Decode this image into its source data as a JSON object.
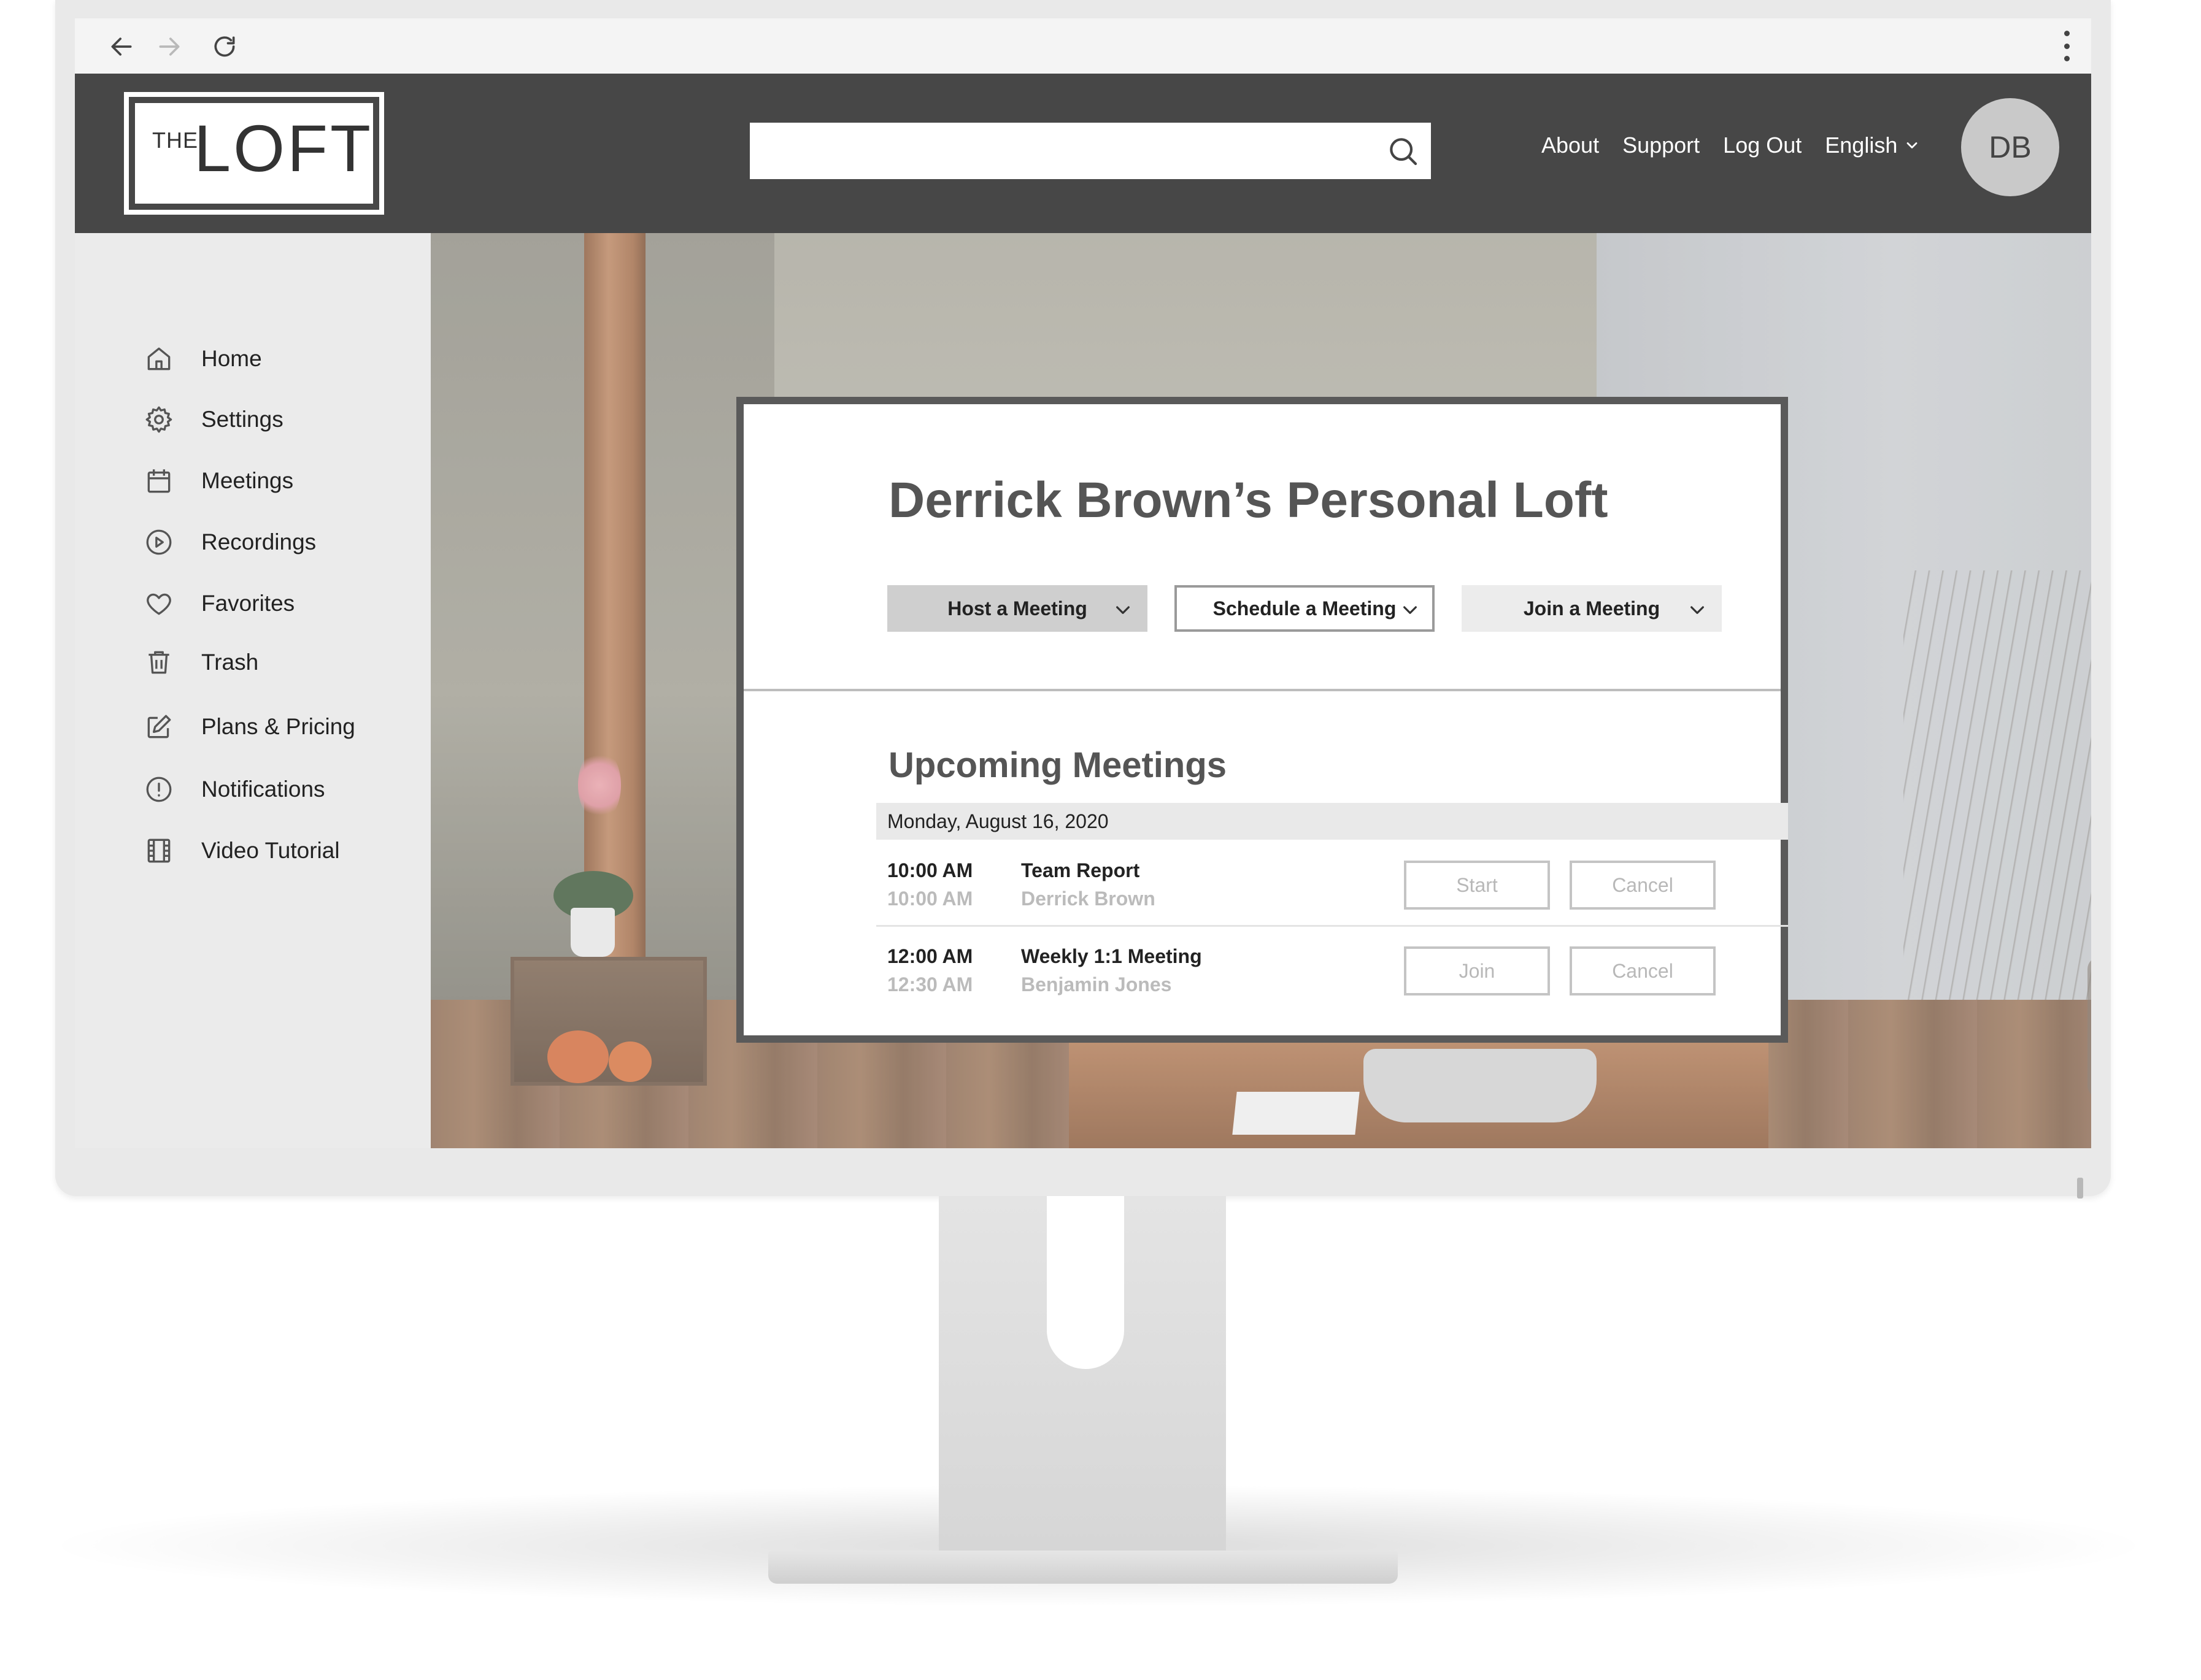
{
  "browser": {
    "icons": [
      "back-arrow-icon",
      "forward-arrow-icon",
      "reload-icon",
      "more-vert-icon"
    ]
  },
  "header": {
    "logo_small": "THE",
    "logo_big": "LOFT",
    "search_placeholder": "",
    "links": [
      "About",
      "Support",
      "Log Out"
    ],
    "language": "English",
    "avatar_initials": "DB"
  },
  "sidebar": {
    "items": [
      {
        "label": "Home",
        "icon": "home-icon"
      },
      {
        "label": "Settings",
        "icon": "gear-icon"
      },
      {
        "label": "Meetings",
        "icon": "calendar-icon"
      },
      {
        "label": "Recordings",
        "icon": "play-circle-icon"
      },
      {
        "label": "Favorites",
        "icon": "heart-icon"
      },
      {
        "label": "Trash",
        "icon": "trash-icon"
      },
      {
        "label": "Plans & Pricing",
        "icon": "edit-icon"
      },
      {
        "label": "Notifications",
        "icon": "alert-circle-icon"
      },
      {
        "label": "Video Tutorial",
        "icon": "film-icon"
      }
    ]
  },
  "card": {
    "title": "Derrick Brown’s Personal Loft",
    "actions": {
      "host": "Host a Meeting",
      "schedule": "Schedule a Meeting",
      "join": "Join a Meeting"
    },
    "upcoming_title": "Upcoming Meetings",
    "date": "Monday, August 16, 2020",
    "meetings": [
      {
        "start": "10:00 AM",
        "end": "10:00 AM",
        "name": "Team Report",
        "host": "Derrick Brown",
        "action": "Start",
        "cancel": "Cancel"
      },
      {
        "start": "12:00 AM",
        "end": "12:30 AM",
        "name": "Weekly 1:1 Meeting",
        "host": "Benjamin Jones",
        "action": "Join",
        "cancel": "Cancel"
      }
    ]
  },
  "colors": {
    "header_bg": "#474747",
    "sidebar_bg": "#ebebeb",
    "card_border": "#5a5a5a",
    "title_text": "#555555"
  }
}
